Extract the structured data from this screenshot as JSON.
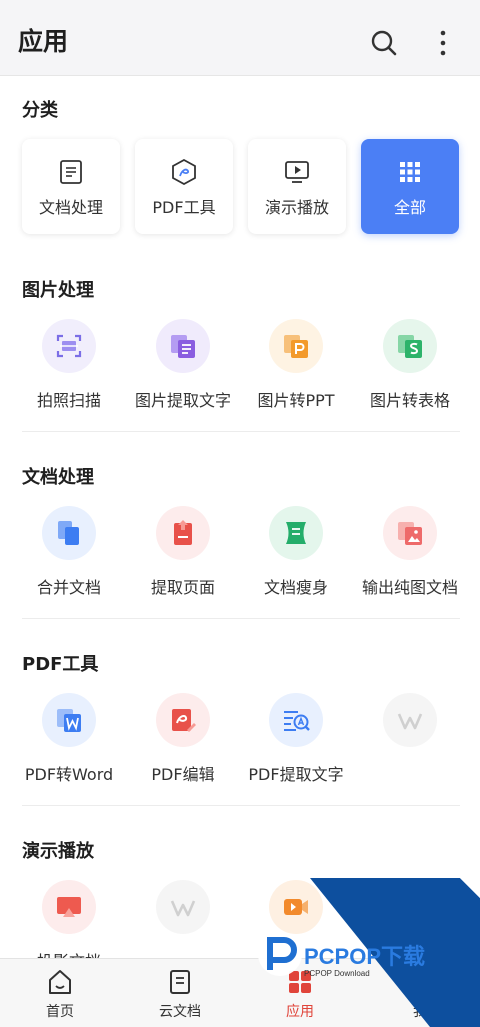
{
  "header": {
    "title": "应用",
    "search_icon": "search-icon",
    "more_icon": "more-vertical-icon"
  },
  "categories": {
    "title": "分类",
    "items": [
      {
        "label": "文档处理",
        "icon": "document-icon",
        "active": false
      },
      {
        "label": "PDF工具",
        "icon": "pdf-icon",
        "active": false
      },
      {
        "label": "演示播放",
        "icon": "presentation-icon",
        "active": false
      },
      {
        "label": "全部",
        "icon": "grid-icon",
        "active": true
      }
    ]
  },
  "sections": [
    {
      "title": "图片处理",
      "tools": [
        {
          "label": "拍照扫描",
          "icon": "scan-icon",
          "color": "#7b6ee6"
        },
        {
          "label": "图片提取文字",
          "icon": "image-to-text-icon",
          "color": "#8a5de0"
        },
        {
          "label": "图片转PPT",
          "icon": "image-to-ppt-icon",
          "color": "#f39a2b"
        },
        {
          "label": "图片转表格",
          "icon": "image-to-sheet-icon",
          "color": "#2db36a"
        }
      ]
    },
    {
      "title": "文档处理",
      "tools": [
        {
          "label": "合并文档",
          "icon": "merge-docs-icon",
          "color": "#3d7df2"
        },
        {
          "label": "提取页面",
          "icon": "extract-page-icon",
          "color": "#e8514a"
        },
        {
          "label": "文档瘦身",
          "icon": "slim-doc-icon",
          "color": "#24ad6a"
        },
        {
          "label": "输出纯图文档",
          "icon": "image-doc-icon",
          "color": "#ee6a6a"
        }
      ]
    },
    {
      "title": "PDF工具",
      "tools": [
        {
          "label": "PDF转Word",
          "icon": "pdf-to-word-icon",
          "color": "#3d7df2"
        },
        {
          "label": "PDF编辑",
          "icon": "pdf-edit-icon",
          "color": "#e8514a"
        },
        {
          "label": "PDF提取文字",
          "icon": "pdf-extract-text-icon",
          "color": "#3d7df2"
        },
        {
          "label": "",
          "icon": "wps-placeholder-icon",
          "color": "#d8d8d8"
        }
      ]
    },
    {
      "title": "演示播放",
      "tools": [
        {
          "label": "投影文档",
          "icon": "projection-icon",
          "color": "#ee5a4f"
        },
        {
          "label": "",
          "icon": "wps-placeholder-icon",
          "color": "#d8d8d8"
        },
        {
          "label": "",
          "icon": "video-icon",
          "color": "#f28a2c"
        }
      ]
    }
  ],
  "bottom_nav": [
    {
      "label": "首页",
      "icon": "home-icon",
      "active": false
    },
    {
      "label": "云文档",
      "icon": "cloud-doc-icon",
      "active": false
    },
    {
      "label": "应用",
      "icon": "apps-icon",
      "active": true
    },
    {
      "label": "我",
      "icon": "profile-icon",
      "active": false
    }
  ],
  "watermark": {
    "brand": "PCPOP下载",
    "sub": "PCPOP Download"
  },
  "colors": {
    "accent": "#4b7ff5",
    "nav_active": "#e0443a"
  }
}
